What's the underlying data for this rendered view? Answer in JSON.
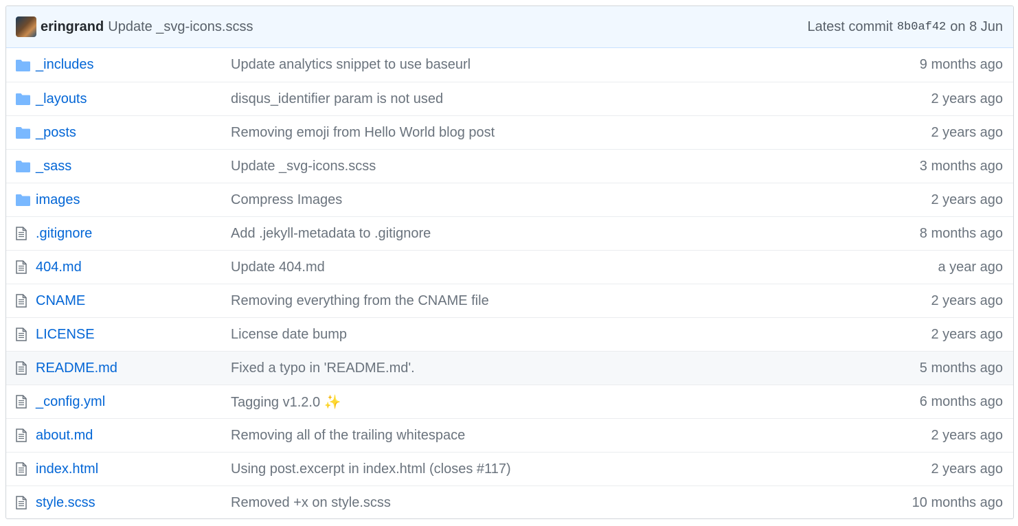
{
  "commit": {
    "author": "eringrand",
    "message": "Update _svg-icons.scss",
    "latest_label": "Latest commit",
    "sha": "8b0af42",
    "date": "on 8 Jun"
  },
  "colors": {
    "link": "#0366d6",
    "folder_icon": "#79b8ff",
    "file_icon": "#6a737d",
    "muted": "#6a737d"
  },
  "files": [
    {
      "name": "_includes",
      "type": "folder",
      "message": "Update analytics snippet to use baseurl",
      "age": "9 months ago"
    },
    {
      "name": "_layouts",
      "type": "folder",
      "message": "disqus_identifier param is not used",
      "age": "2 years ago"
    },
    {
      "name": "_posts",
      "type": "folder",
      "message": "Removing emoji from Hello World blog post",
      "age": "2 years ago"
    },
    {
      "name": "_sass",
      "type": "folder",
      "message": "Update _svg-icons.scss",
      "age": "3 months ago"
    },
    {
      "name": "images",
      "type": "folder",
      "message": "Compress Images",
      "age": "2 years ago"
    },
    {
      "name": ".gitignore",
      "type": "file",
      "message": "Add .jekyll-metadata to .gitignore",
      "age": "8 months ago"
    },
    {
      "name": "404.md",
      "type": "file",
      "message": "Update 404.md",
      "age": "a year ago"
    },
    {
      "name": "CNAME",
      "type": "file",
      "message": "Removing everything from the CNAME file",
      "age": "2 years ago"
    },
    {
      "name": "LICENSE",
      "type": "file",
      "message": "License date bump",
      "age": "2 years ago"
    },
    {
      "name": "README.md",
      "type": "file",
      "message": "Fixed a typo in 'README.md'.",
      "age": "5 months ago",
      "highlight": true
    },
    {
      "name": "_config.yml",
      "type": "file",
      "message": "Tagging v1.2.0 ✨",
      "age": "6 months ago"
    },
    {
      "name": "about.md",
      "type": "file",
      "message": "Removing all of the trailing whitespace",
      "age": "2 years ago"
    },
    {
      "name": "index.html",
      "type": "file",
      "message": "Using post.excerpt in index.html (closes #117)",
      "age": "2 years ago"
    },
    {
      "name": "style.scss",
      "type": "file",
      "message": "Removed +x on style.scss",
      "age": "10 months ago"
    }
  ]
}
